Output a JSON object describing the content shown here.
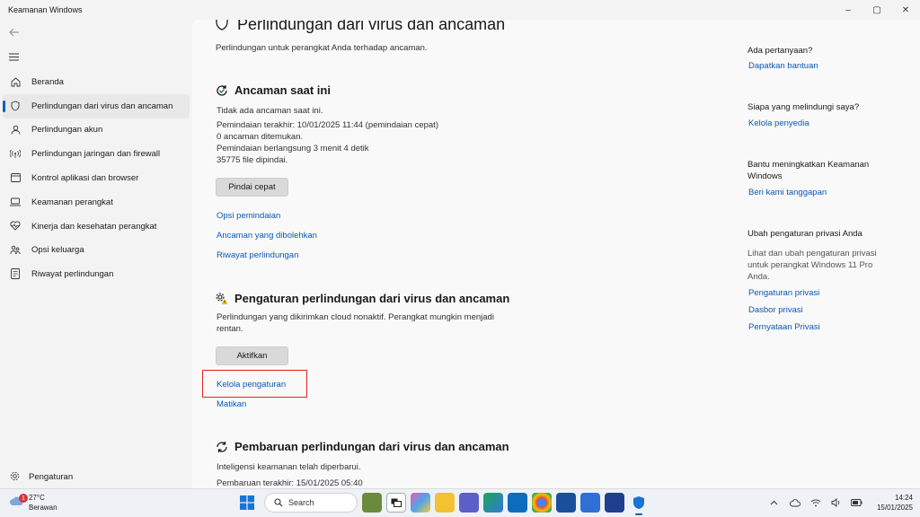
{
  "window": {
    "title": "Keamanan Windows",
    "controls": [
      "–",
      "▢",
      "✕"
    ]
  },
  "sidebar": {
    "items": [
      {
        "label": "Beranda",
        "icon": "home-icon"
      },
      {
        "label": "Perlindungan dari virus dan ancaman",
        "icon": "shield-icon",
        "active": true
      },
      {
        "label": "Perlindungan akun",
        "icon": "person-icon"
      },
      {
        "label": "Perlindungan jaringan dan firewall",
        "icon": "wifi-signal-icon"
      },
      {
        "label": "Kontrol aplikasi dan browser",
        "icon": "app-window-icon"
      },
      {
        "label": "Keamanan perangkat",
        "icon": "laptop-icon"
      },
      {
        "label": "Kinerja dan kesehatan perangkat",
        "icon": "heart-pulse-icon"
      },
      {
        "label": "Opsi keluarga",
        "icon": "family-icon"
      },
      {
        "label": "Riwayat perlindungan",
        "icon": "history-icon"
      }
    ],
    "settings_label": "Pengaturan"
  },
  "main": {
    "title": "Perlindungan dari virus dan ancaman",
    "subtitle": "Perlindungan untuk perangkat Anda terhadap ancaman.",
    "current_threats": {
      "heading": "Ancaman saat ini",
      "no_threats": "Tidak ada ancaman saat ini.",
      "last_scan": "Pemindaian terakhir: 10/01/2025 11:44 (pemindaian cepat)",
      "threats_found": "0 ancaman ditemukan.",
      "scan_duration": "Pemindaian berlangsung 3 menit 4 detik",
      "files_scanned": "35775 file dipindai.",
      "quick_scan_button": "Pindai cepat",
      "links": [
        "Opsi pemindaian",
        "Ancaman yang dibolehkan",
        "Riwayat perlindungan"
      ]
    },
    "settings": {
      "heading": "Pengaturan perlindungan dari virus dan ancaman",
      "description": "Perlindungan yang dikirimkan cloud nonaktif. Perangkat mungkin menjadi rentan.",
      "enable_button": "Aktifkan",
      "manage_link": "Kelola pengaturan",
      "disable_link": "Matikan"
    },
    "updates": {
      "heading": "Pembaruan perlindungan dari virus dan ancaman",
      "status": "Inteligensi keamanan telah diperbarui.",
      "last_update": "Pembaruan terakhir: 15/01/2025 05:40"
    }
  },
  "right": {
    "q1": "Ada pertanyaan?",
    "l1": "Dapatkan bantuan",
    "q2": "Siapa yang melindungi saya?",
    "l2": "Kelola penyedia",
    "q3": "Bantu meningkatkan Keamanan Windows",
    "l3": "Beri kami tanggapan",
    "q4": "Ubah pengaturan privasi Anda",
    "t4": "Lihat dan ubah pengaturan privasi untuk perangkat Windows 11 Pro Anda.",
    "l4a": "Pengaturan privasi",
    "l4b": "Dasbor privasi",
    "l4c": "Pernyataan Privasi"
  },
  "taskbar": {
    "weather_temp": "27°C",
    "weather_desc": "Berawan",
    "weather_badge": "1",
    "search_placeholder": "Search",
    "time": "14:24",
    "date": "15/01/2025",
    "colors": {
      "accent": "#005fb8",
      "link": "#0a58b3",
      "highlight": "#e02020"
    }
  }
}
